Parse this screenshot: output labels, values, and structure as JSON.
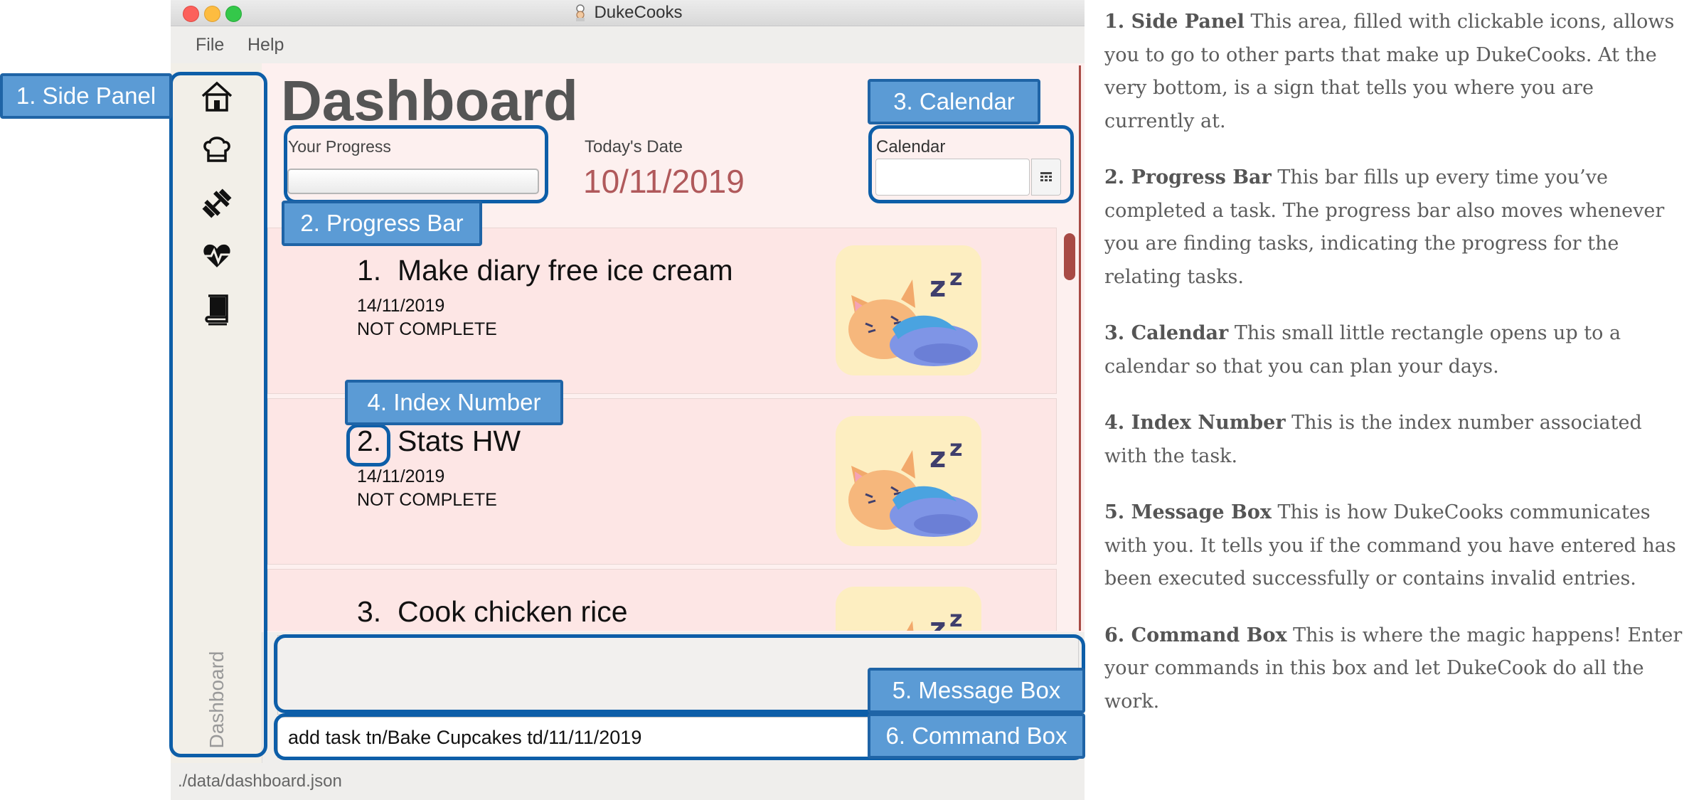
{
  "window": {
    "title": "DukeCooks",
    "menu": [
      "File",
      "Help"
    ],
    "status_path": "./data/dashboard.json"
  },
  "side_panel": {
    "icons": [
      "home-icon",
      "chef-hat-icon",
      "dumbbell-icon",
      "heartbeat-icon",
      "book-icon"
    ],
    "current": "Dashboard"
  },
  "dashboard": {
    "title": "Dashboard",
    "progress_label": "Your Progress",
    "progress": 0,
    "date_label": "Today's Date",
    "date": "10/11/2019",
    "calendar_label": "Calendar"
  },
  "tasks": [
    {
      "index": "1.",
      "name": "Make diary free ice cream",
      "date": "14/11/2019",
      "status": "NOT COMPLETE"
    },
    {
      "index": "2.",
      "name": "Stats HW",
      "date": "14/11/2019",
      "status": "NOT COMPLETE"
    },
    {
      "index": "3.",
      "name": "Cook chicken rice"
    }
  ],
  "command_box": {
    "value": "add task tn/Bake Cupcakes td/11/11/2019"
  },
  "callouts": {
    "side_panel": "1. Side Panel",
    "calendar": "3. Calendar",
    "progress_bar": "2. Progress Bar",
    "index_number": "4. Index Number",
    "message_box": "5. Message Box",
    "command_box": "6. Command Box"
  },
  "colors": {
    "accent": "#a84a45",
    "callout_fill": "#5b9bd5",
    "callout_border": "#0d5ea8",
    "card_bg": "#fde6e5"
  },
  "help": [
    {
      "title": "1. Side Panel",
      "body": " This area, filled with clickable icons, allows you to go to other parts that make up DukeCooks. At the very bottom, is a sign that tells you where you are currently at."
    },
    {
      "title": "2. Progress Bar",
      "body": " This bar fills up every time you’ve completed a task. The progress bar also moves whenever you are finding tasks, indicating the progress for the relating tasks."
    },
    {
      "title": "3. Calendar",
      "body": " This small little rectangle opens up to a calendar so that you can plan your days."
    },
    {
      "title": "4. Index Number",
      "body": " This is the index number associated with the task."
    },
    {
      "title": "5. Message Box",
      "body": " This is how DukeCooks communicates with you. It tells you if the command you have entered has been executed successfully or contains invalid entries."
    },
    {
      "title": "6. Command Box",
      "body": " This is where the magic happens! Enter your commands in this box and let DukeCook do all the work."
    }
  ]
}
